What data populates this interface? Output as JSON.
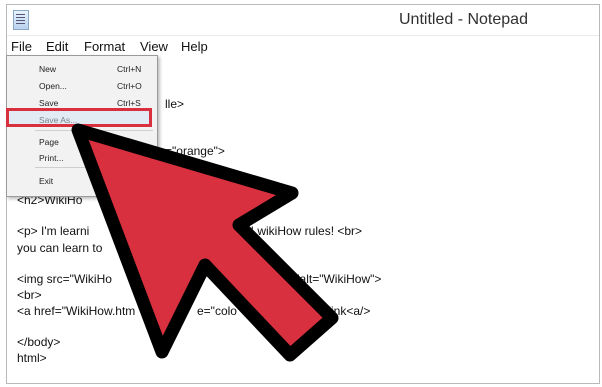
{
  "window": {
    "title": "Untitled - Notepad"
  },
  "menubar": {
    "items": [
      "File",
      "Edit",
      "Format",
      "View",
      "Help"
    ]
  },
  "file_menu": {
    "items": [
      {
        "label": "New",
        "shortcut": "Ctrl+N"
      },
      {
        "label": "Open...",
        "shortcut": "Ctrl+O"
      },
      {
        "label": "Save",
        "shortcut": "Ctrl+S"
      },
      {
        "label": "Save As...",
        "shortcut": ""
      },
      {
        "label": "Page",
        "shortcut": ""
      },
      {
        "label": "Print...",
        "shortcut": ""
      },
      {
        "label": "Exit",
        "shortcut": ""
      }
    ],
    "highlighted": "Save As..."
  },
  "editor": {
    "lines": [
      "lle>",
      "=\"orange\">",
      "<h2>WikiHo",
      "<p> I'm learni",
      "e! wikiHow rules! <br>",
      "you can learn to",
      "<img src=\"WikiHo",
      "\"200\"alt=\"WikiHow\">",
      "<br>",
      "<a href=\"WikiHow.htm",
      "e=\"colo",
      "k the link<a/>",
      "</body>",
      "html>"
    ]
  },
  "colors": {
    "accent_red": "#d9303f",
    "arrow_outline": "#000000"
  },
  "icons": {
    "app": "notepad-icon",
    "overlay": "pointer-arrow-icon"
  }
}
